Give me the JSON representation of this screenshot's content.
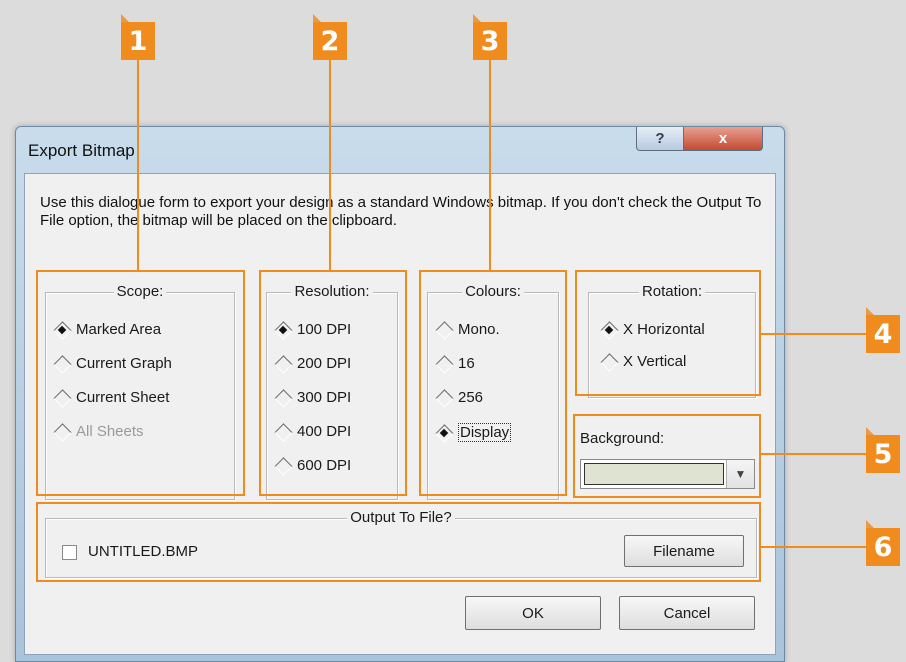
{
  "callouts": [
    "1",
    "2",
    "3",
    "4",
    "5",
    "6"
  ],
  "colors": {
    "accent": "#f08c1e",
    "background_swatch": "#dfe3d2"
  },
  "window": {
    "title": "Export Bitmap",
    "help_label": "?",
    "close_label": "x"
  },
  "description": "Use this dialogue form to export your design as a standard Windows bitmap. If you don't check the Output To File option, the bitmap will be placed on the clipboard.",
  "scope": {
    "legend": "Scope:",
    "options": [
      {
        "label": "Marked Area",
        "selected": true,
        "enabled": true
      },
      {
        "label": "Current Graph",
        "selected": false,
        "enabled": true
      },
      {
        "label": "Current Sheet",
        "selected": false,
        "enabled": true
      },
      {
        "label": "All Sheets",
        "selected": false,
        "enabled": false
      }
    ]
  },
  "resolution": {
    "legend": "Resolution:",
    "options": [
      {
        "label": "100 DPI",
        "selected": true
      },
      {
        "label": "200 DPI",
        "selected": false
      },
      {
        "label": "300 DPI",
        "selected": false
      },
      {
        "label": "400 DPI",
        "selected": false
      },
      {
        "label": "600 DPI",
        "selected": false
      }
    ]
  },
  "colours": {
    "legend": "Colours:",
    "options": [
      {
        "label": "Mono.",
        "selected": false
      },
      {
        "label": "16",
        "selected": false
      },
      {
        "label": "256",
        "selected": false
      },
      {
        "label": "Display",
        "selected": true
      }
    ]
  },
  "rotation": {
    "legend": "Rotation:",
    "options": [
      {
        "label": "X Horizontal",
        "selected": true
      },
      {
        "label": "X Vertical",
        "selected": false
      }
    ]
  },
  "background": {
    "label": "Background:",
    "icon": "chevron-down-icon"
  },
  "output": {
    "legend": "Output To File?",
    "file_label": "UNTITLED.BMP",
    "checked": false,
    "filename_button": "Filename"
  },
  "buttons": {
    "ok": "OK",
    "cancel": "Cancel"
  }
}
